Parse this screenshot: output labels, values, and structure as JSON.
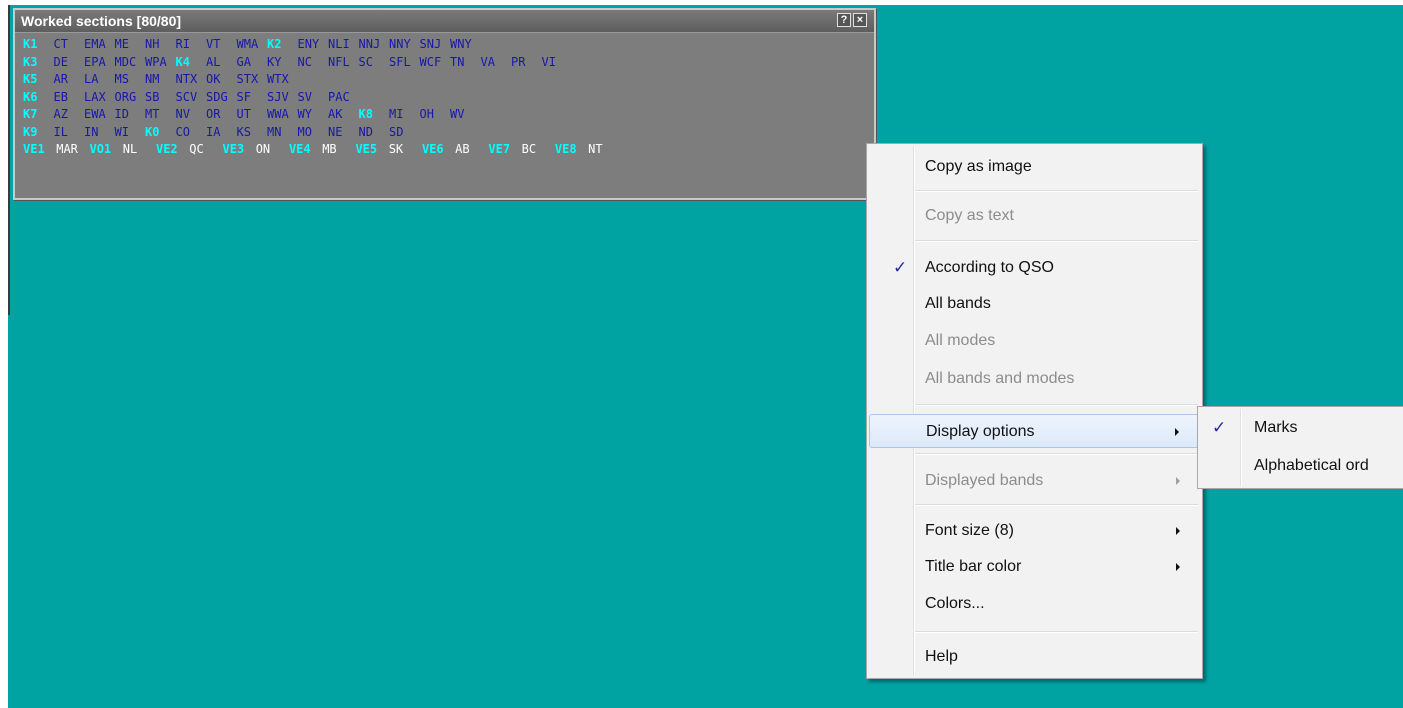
{
  "worked_sections": {
    "title": "Worked sections [80/80]",
    "help_button": "?",
    "close_button": "×",
    "rows": [
      [
        {
          "t": "K1",
          "k": "dist"
        },
        {
          "t": "CT",
          "k": "sec"
        },
        {
          "t": "EMA",
          "k": "sec"
        },
        {
          "t": "ME",
          "k": "sec"
        },
        {
          "t": "NH",
          "k": "sec"
        },
        {
          "t": "RI",
          "k": "sec"
        },
        {
          "t": "VT",
          "k": "sec"
        },
        {
          "t": "WMA",
          "k": "sec"
        },
        {
          "t": "K2",
          "k": "dist"
        },
        {
          "t": "ENY",
          "k": "sec"
        },
        {
          "t": "NLI",
          "k": "sec"
        },
        {
          "t": "NNJ",
          "k": "sec"
        },
        {
          "t": "NNY",
          "k": "sec"
        },
        {
          "t": "SNJ",
          "k": "sec"
        },
        {
          "t": "WNY",
          "k": "sec"
        }
      ],
      [
        {
          "t": "K3",
          "k": "dist"
        },
        {
          "t": "DE",
          "k": "sec"
        },
        {
          "t": "EPA",
          "k": "sec"
        },
        {
          "t": "MDC",
          "k": "sec"
        },
        {
          "t": "WPA",
          "k": "sec"
        },
        {
          "t": "K4",
          "k": "dist"
        },
        {
          "t": "AL",
          "k": "sec"
        },
        {
          "t": "GA",
          "k": "sec"
        },
        {
          "t": "KY",
          "k": "sec"
        },
        {
          "t": "NC",
          "k": "sec"
        },
        {
          "t": "NFL",
          "k": "sec"
        },
        {
          "t": "SC",
          "k": "sec"
        },
        {
          "t": "SFL",
          "k": "sec"
        },
        {
          "t": "WCF",
          "k": "sec"
        },
        {
          "t": "TN",
          "k": "sec"
        },
        {
          "t": "VA",
          "k": "sec"
        },
        {
          "t": "PR",
          "k": "sec"
        },
        {
          "t": "VI",
          "k": "sec"
        }
      ],
      [
        {
          "t": "K5",
          "k": "dist"
        },
        {
          "t": "AR",
          "k": "sec"
        },
        {
          "t": "LA",
          "k": "sec"
        },
        {
          "t": "MS",
          "k": "sec"
        },
        {
          "t": "NM",
          "k": "sec"
        },
        {
          "t": "NTX",
          "k": "sec"
        },
        {
          "t": "OK",
          "k": "sec"
        },
        {
          "t": "STX",
          "k": "sec"
        },
        {
          "t": "WTX",
          "k": "sec"
        }
      ],
      [
        {
          "t": "K6",
          "k": "dist"
        },
        {
          "t": "EB",
          "k": "sec"
        },
        {
          "t": "LAX",
          "k": "sec"
        },
        {
          "t": "ORG",
          "k": "sec"
        },
        {
          "t": "SB",
          "k": "sec"
        },
        {
          "t": "SCV",
          "k": "sec"
        },
        {
          "t": "SDG",
          "k": "sec"
        },
        {
          "t": "SF",
          "k": "sec"
        },
        {
          "t": "SJV",
          "k": "sec"
        },
        {
          "t": "SV",
          "k": "sec"
        },
        {
          "t": "PAC",
          "k": "sec"
        }
      ],
      [
        {
          "t": "K7",
          "k": "dist"
        },
        {
          "t": "AZ",
          "k": "sec"
        },
        {
          "t": "EWA",
          "k": "sec"
        },
        {
          "t": "ID",
          "k": "sec"
        },
        {
          "t": "MT",
          "k": "sec"
        },
        {
          "t": "NV",
          "k": "sec"
        },
        {
          "t": "OR",
          "k": "sec"
        },
        {
          "t": "UT",
          "k": "sec"
        },
        {
          "t": "WWA",
          "k": "sec"
        },
        {
          "t": "WY",
          "k": "sec"
        },
        {
          "t": "AK",
          "k": "sec"
        },
        {
          "t": "K8",
          "k": "dist"
        },
        {
          "t": "MI",
          "k": "sec"
        },
        {
          "t": "OH",
          "k": "sec"
        },
        {
          "t": "WV",
          "k": "sec"
        }
      ],
      [
        {
          "t": "K9",
          "k": "dist"
        },
        {
          "t": "IL",
          "k": "sec"
        },
        {
          "t": "IN",
          "k": "sec"
        },
        {
          "t": "WI",
          "k": "sec"
        },
        {
          "t": "K0",
          "k": "dist"
        },
        {
          "t": "CO",
          "k": "sec"
        },
        {
          "t": "IA",
          "k": "sec"
        },
        {
          "t": "KS",
          "k": "sec"
        },
        {
          "t": "MN",
          "k": "sec"
        },
        {
          "t": "MO",
          "k": "sec"
        },
        {
          "t": "NE",
          "k": "sec"
        },
        {
          "t": "ND",
          "k": "sec"
        },
        {
          "t": "SD",
          "k": "sec"
        }
      ],
      [
        {
          "t": "VE1",
          "k": "dist"
        },
        {
          "t": "MAR",
          "k": "ve"
        },
        {
          "t": "VO1",
          "k": "dist"
        },
        {
          "t": "NL",
          "k": "ve"
        },
        {
          "t": "VE2",
          "k": "dist"
        },
        {
          "t": "QC",
          "k": "ve"
        },
        {
          "t": "VE3",
          "k": "dist"
        },
        {
          "t": "ON",
          "k": "ve"
        },
        {
          "t": "VE4",
          "k": "dist"
        },
        {
          "t": "MB",
          "k": "ve"
        },
        {
          "t": "VE5",
          "k": "dist"
        },
        {
          "t": "SK",
          "k": "ve"
        },
        {
          "t": "VE6",
          "k": "dist"
        },
        {
          "t": "AB",
          "k": "ve"
        },
        {
          "t": "VE7",
          "k": "dist"
        },
        {
          "t": "BC",
          "k": "ve"
        },
        {
          "t": "VE8",
          "k": "dist"
        },
        {
          "t": "NT",
          "k": "ve"
        }
      ]
    ]
  },
  "context_menu": {
    "copy_image": "Copy as image",
    "copy_text": "Copy as text",
    "according_qso": "According to QSO",
    "all_bands": "All bands",
    "all_modes": "All modes",
    "all_bands_modes": "All bands and modes",
    "display_options": "Display options",
    "displayed_bands": "Displayed bands",
    "font_size": "Font size (8)",
    "title_bar_color": "Title bar color",
    "colors": "Colors...",
    "help": "Help",
    "checkmark": "✓"
  },
  "submenu": {
    "marks": "Marks",
    "alphabetical": "Alphabetical ord",
    "checkmark": "✓"
  },
  "colors": {
    "desktop": "#00a2a2",
    "window_bg": "#7d7d7d",
    "district": "#00ffff",
    "section": "#1818a8",
    "canada_section": "#ffffff"
  }
}
